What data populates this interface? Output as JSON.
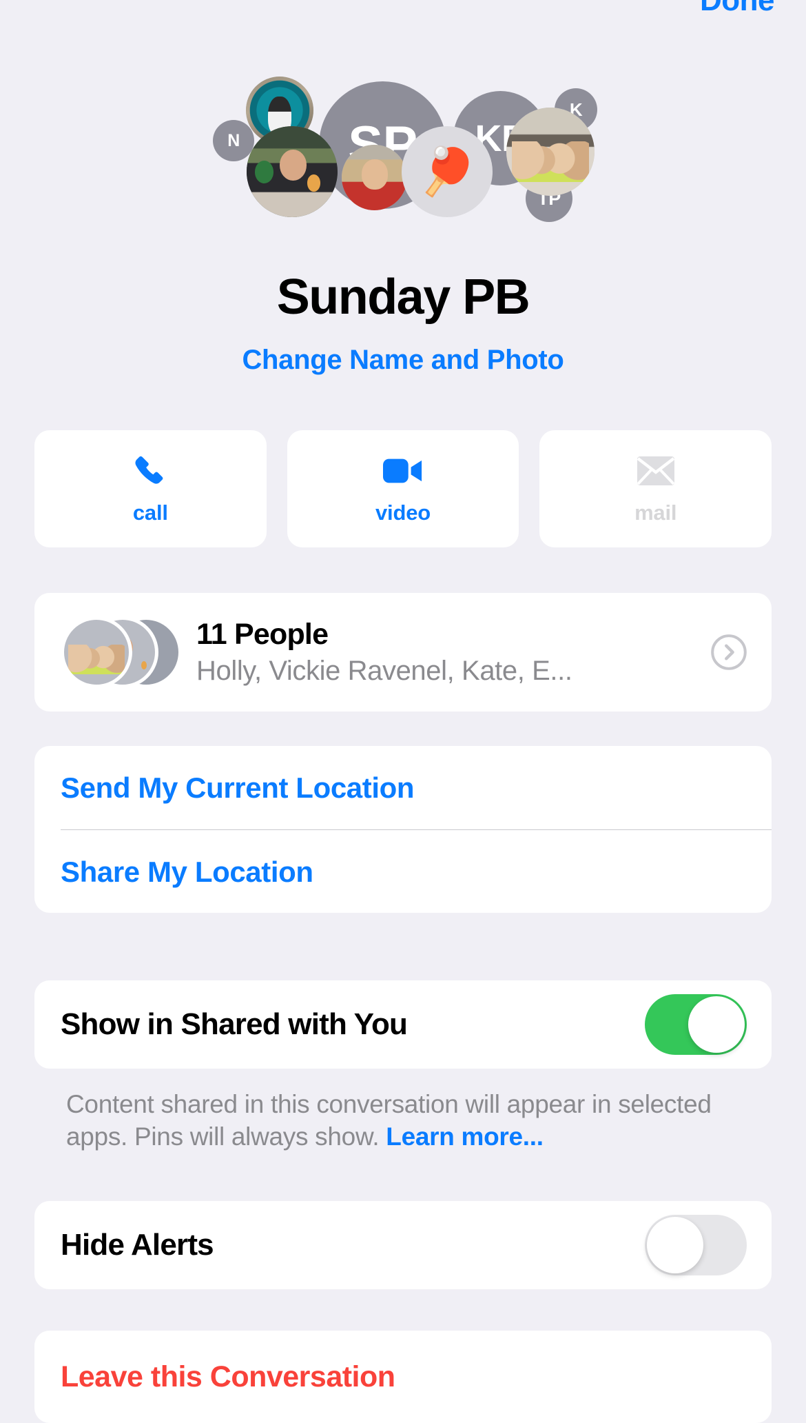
{
  "navbar": {
    "done_label": "Done"
  },
  "header": {
    "group_name": "Sunday PB",
    "change_link": "Change Name and Photo",
    "avatars": [
      {
        "id": "av-dog",
        "kind": "photo",
        "initials": ""
      },
      {
        "id": "av-sp",
        "kind": "initials",
        "initials": "SP"
      },
      {
        "id": "av-kp",
        "kind": "initials",
        "initials": "KP"
      },
      {
        "id": "av-k",
        "kind": "initials",
        "initials": "K"
      },
      {
        "id": "av-n",
        "kind": "initials",
        "initials": "N"
      },
      {
        "id": "av-tp",
        "kind": "initials",
        "initials": "TP"
      },
      {
        "id": "av-two",
        "kind": "photo",
        "initials": ""
      },
      {
        "id": "av-blond",
        "kind": "photo",
        "initials": ""
      },
      {
        "id": "av-ping",
        "kind": "emoji",
        "initials": "🏓"
      },
      {
        "id": "av-grp",
        "kind": "photo",
        "initials": ""
      }
    ]
  },
  "actions": [
    {
      "label": "call",
      "icon": "phone-icon",
      "enabled": true
    },
    {
      "label": "video",
      "icon": "video-icon",
      "enabled": true
    },
    {
      "label": "mail",
      "icon": "mail-icon",
      "enabled": false
    }
  ],
  "people": {
    "count_label": "11 People",
    "names": "Holly, Vickie Ravenel, Kate, E...",
    "chevron": "chevron-right-circle-icon"
  },
  "location": {
    "send_current": "Send My Current Location",
    "share": "Share My Location"
  },
  "shared_with_you": {
    "label": "Show in Shared with You",
    "enabled": true,
    "footnote_text": "Content shared in this conversation will appear in selected apps. Pins will always show. ",
    "footnote_link": "Learn more..."
  },
  "hide_alerts": {
    "label": "Hide Alerts",
    "enabled": false
  },
  "leave": {
    "label": "Leave this Conversation"
  },
  "colors": {
    "background": "#f0eff5",
    "card": "#ffffff",
    "accent_blue": "#0a7cff",
    "toggle_green": "#34c759",
    "destructive_red": "#f9423a",
    "secondary_text": "#8a8a8e",
    "disabled": "#d6d6d8"
  }
}
